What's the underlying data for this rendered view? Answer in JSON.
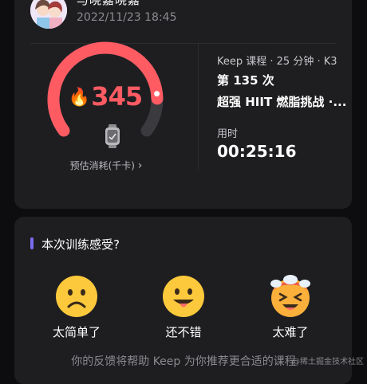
{
  "header": {
    "user_name": "与晓嘉晓嘉",
    "timestamp": "2022/11/23 18:45"
  },
  "summary": {
    "kcal_value": "345",
    "kcal_label": "预估消耗(千卡)",
    "kcal_chevron": "›",
    "kcal_progress": 0.85,
    "accent_color": "#ff5b63",
    "course_meta": "Keep 课程 · 25 分钟 · K3",
    "session_count": "第 135 次",
    "course_title": "超强 HIIT 燃脂挑战 ·...",
    "duration_label": "用时",
    "duration_value": "00:25:16"
  },
  "feedback": {
    "title": "本次训练感受?",
    "options": [
      {
        "label": "太简单了",
        "icon": "frowning-face-icon"
      },
      {
        "label": "还不错",
        "icon": "tongue-face-icon"
      },
      {
        "label": "太难了",
        "icon": "sweating-hot-face-icon"
      }
    ],
    "footer_note": "你的反馈将帮助 Keep 为你推荐更合适的课程"
  },
  "watermark": "@稀土掘金技术社区"
}
